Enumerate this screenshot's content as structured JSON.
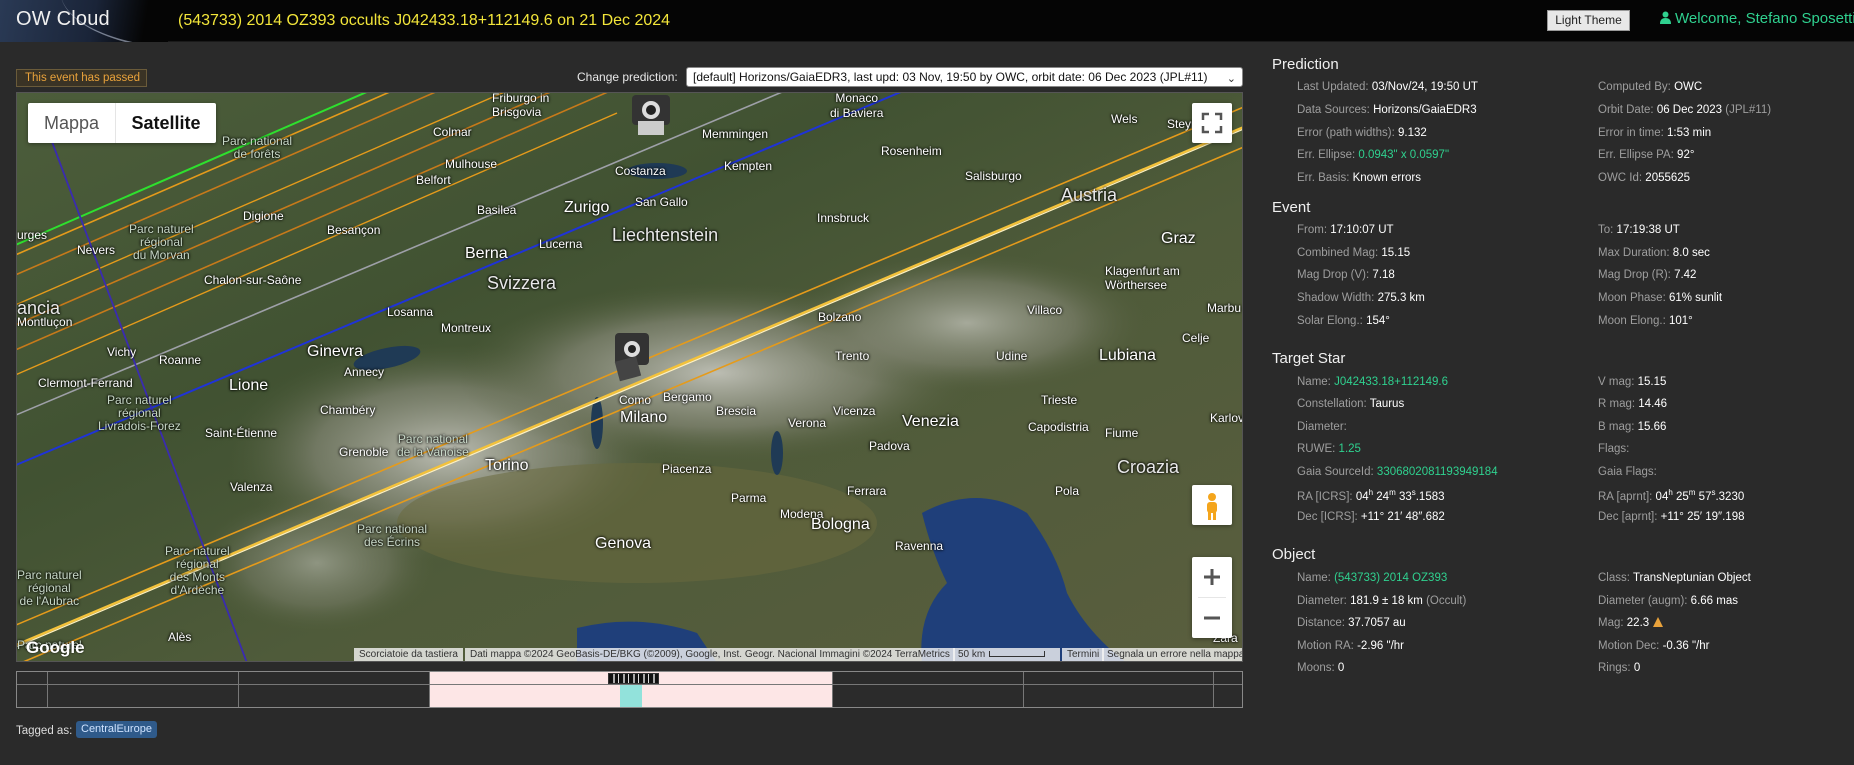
{
  "header": {
    "app_name": "OW Cloud",
    "page_title": "(543733) 2014 OZ393 occults J042433.18+112149.6 on 21 Dec 2024",
    "theme_button": "Light Theme",
    "welcome": "Welcome, Stefano Sposetti"
  },
  "event_status": "This event has passed",
  "prediction_selector": {
    "label": "Change prediction:",
    "selected": "[default] Horizons/GaiaEDR3, last upd: 03 Nov, 19:50 by OWC, orbit date: 06 Dec 2023 (JPL#11)"
  },
  "map": {
    "type_map": "Mappa",
    "type_satellite": "Satellite",
    "logo": "Google",
    "attribution_shortcuts": "Scorciatoie da tastiera",
    "attribution_data": "Dati mappa ©2024 GeoBasis-DE/BKG (©2009), Google, Inst. Geogr. Nacional Immagini ©2024 TerraMetrics",
    "scale": "50 km",
    "terms": "Termini",
    "report": "Segnala un errore nella mappa",
    "labels": {
      "monaco": "Monaco\ndi Baviera",
      "friburgo": "Friburgo in\nBrisgovia",
      "colmar": "Colmar",
      "memmingen": "Memmingen",
      "welsb": "Wels",
      "steyr": "Steyr",
      "kempten": "Kempten",
      "rosenheim": "Rosenheim",
      "mulhouse": "Mulhouse",
      "belfort": "Belfort",
      "costanza": "Costanza",
      "salisburgo": "Salisburgo",
      "austria": "Austria",
      "basilea": "Basilea",
      "zurigo": "Zurigo",
      "sangallo": "San Gallo",
      "digione": "Digione",
      "besancon": "Besançon",
      "innsbruck": "Innsbruck",
      "liechtenstein": "Liechtenstein",
      "lucerna": "Lucerna",
      "graz": "Graz",
      "nevers": "Nevers",
      "berna": "Berna",
      "chalon": "Chalon-sur-Saône",
      "svizzera": "Svizzera",
      "klagenfurt": "Klagenfurt am\nWörthersee",
      "villaco": "Villaco",
      "marbu": "Marbu",
      "losanna": "Losanna",
      "montreux": "Montreux",
      "bolzano": "Bolzano",
      "montlucon": "Montluçon",
      "vichy": "Vichy",
      "ginevra": "Ginevra",
      "trento": "Trento",
      "udine": "Udine",
      "lubiana": "Lubiana",
      "celje": "Celje",
      "roanne": "Roanne",
      "annecy": "Annecy",
      "clermont": "Clermont-Ferrand",
      "lione": "Lione",
      "como": "Como",
      "bergamo": "Bergamo",
      "trieste": "Trieste",
      "chambery": "Chambéry",
      "milano": "Milano",
      "brescia": "Brescia",
      "verona": "Verona",
      "vicenza": "Vicenza",
      "venezia": "Venezia",
      "capodistria": "Capodistria",
      "karlova": "Karlova",
      "sainteti": "Saint-Étienne",
      "padova": "Padova",
      "fiume": "Fiume",
      "grenoble": "Grenoble",
      "torino": "Torino",
      "croazia": "Croazia",
      "piacenza": "Piacenza",
      "valenza": "Valenza",
      "pola": "Pola",
      "parma": "Parma",
      "ferrara": "Ferrara",
      "modena": "Modena",
      "bologna": "Bologna",
      "genova": "Genova",
      "ravenna": "Ravenna",
      "ales": "Alès",
      "zara": "Zara",
      "bourges": "urges",
      "francia": "ancia",
      "pn_foreti": "Parc national\nde forêts",
      "pn_morvan": "Parc naturel\nrégional\ndu Morvan",
      "pn_livradois": "Parc naturel\nrégional\nLivradois-Forez",
      "pn_vanoise": "Parc national\nde la Vanoise",
      "pn_ecrins": "Parc national\ndes Écrins",
      "pn_monts": "Parc naturel\nrégional\ndes Monts\nd'Ardèche",
      "pn_aubrac": "Parc naturel\nrégional\nde l'Aubrac",
      "pn_top": "Parc naturel"
    }
  },
  "tagged": {
    "label": "Tagged as:",
    "tags": [
      "CentralEurope"
    ]
  },
  "prediction": {
    "title": "Prediction",
    "last_updated": {
      "label": "Last Updated:",
      "value": "03/Nov/24, 19:50 UT"
    },
    "computed_by": {
      "label": "Computed By:",
      "value": "OWC"
    },
    "data_sources": {
      "label": "Data Sources:",
      "value": "Horizons/GaiaEDR3"
    },
    "orbit_date": {
      "label": "Orbit Date:",
      "value": "06 Dec 2023",
      "extra": "(JPL#11)"
    },
    "error_path": {
      "label": "Error (path widths):",
      "value": "9.132"
    },
    "error_time": {
      "label": "Error in time:",
      "value": "1:53 min"
    },
    "err_ellipse": {
      "label": "Err. Ellipse:",
      "value": "0.0943\" x 0.0597\""
    },
    "err_ellipse_pa": {
      "label": "Err. Ellipse PA:",
      "value": "92°"
    },
    "err_basis": {
      "label": "Err. Basis:",
      "value": "Known errors"
    },
    "owc_id": {
      "label": "OWC Id:",
      "value": "2055625"
    }
  },
  "event": {
    "title": "Event",
    "from": {
      "label": "From:",
      "value": "17:10:07 UT"
    },
    "to": {
      "label": "To:",
      "value": "17:19:38 UT"
    },
    "combined_mag": {
      "label": "Combined Mag:",
      "value": "15.15"
    },
    "max_duration": {
      "label": "Max Duration:",
      "value": "8.0 sec"
    },
    "mag_drop_v": {
      "label": "Mag Drop (V):",
      "value": "7.18"
    },
    "mag_drop_r": {
      "label": "Mag Drop (R):",
      "value": "7.42"
    },
    "shadow_width": {
      "label": "Shadow Width:",
      "value": "275.3 km"
    },
    "moon_phase": {
      "label": "Moon Phase:",
      "value": "61% sunlit"
    },
    "solar_elong": {
      "label": "Solar Elong.:",
      "value": "154°"
    },
    "moon_elong": {
      "label": "Moon Elong.:",
      "value": "101°"
    }
  },
  "target_star": {
    "title": "Target Star",
    "name": {
      "label": "Name:",
      "value": "J042433.18+112149.6"
    },
    "v_mag": {
      "label": "V mag:",
      "value": "15.15"
    },
    "constellation": {
      "label": "Constellation:",
      "value": "Taurus"
    },
    "r_mag": {
      "label": "R mag:",
      "value": "14.46"
    },
    "diameter": {
      "label": "Diameter:",
      "value": ""
    },
    "b_mag": {
      "label": "B mag:",
      "value": "15.66"
    },
    "ruwe": {
      "label": "RUWE:",
      "value": "1.25"
    },
    "flags": {
      "label": "Flags:",
      "value": ""
    },
    "gaia_source": {
      "label": "Gaia SourceId:",
      "value": "3306802081193949184"
    },
    "gaia_flags": {
      "label": "Gaia Flags:",
      "value": ""
    },
    "ra_icrs": {
      "label": "RA [ICRS]:",
      "h": "04",
      "m": "24",
      "s": "33",
      "frac": ".1583"
    },
    "ra_aprnt": {
      "label": "RA [aprnt]:",
      "h": "04",
      "m": "25",
      "s": "57",
      "frac": ".3230"
    },
    "dec_icrs": {
      "label": "Dec [ICRS]:",
      "value": "+11° 21′ 48″.682"
    },
    "dec_aprnt": {
      "label": "Dec [aprnt]:",
      "value": "+11° 25′ 19″.198"
    }
  },
  "object": {
    "title": "Object",
    "name": {
      "label": "Name:",
      "value": "(543733) 2014 OZ393"
    },
    "class": {
      "label": "Class:",
      "value": "TransNeptunian Object"
    },
    "diameter": {
      "label": "Diameter:",
      "value": "181.9 ± 18 km",
      "extra": "(Occult)"
    },
    "diameter_augm": {
      "label": "Diameter (augm):",
      "value": "6.66 mas"
    },
    "distance": {
      "label": "Distance:",
      "value": "37.7057 au"
    },
    "mag": {
      "label": "Mag:",
      "value": "22.3"
    },
    "motion_ra": {
      "label": "Motion RA:",
      "value": "-2.96 \"/hr"
    },
    "motion_dec": {
      "label": "Motion Dec:",
      "value": "-0.36 \"/hr"
    },
    "moons": {
      "label": "Moons:",
      "value": "0"
    },
    "rings": {
      "label": "Rings:",
      "value": "0"
    }
  },
  "colors": {
    "accent_green": "#2fd18f",
    "title_yellow": "#f3e63a",
    "warning_orange": "#e9a23b",
    "tag_blue": "#2f5a8a"
  }
}
